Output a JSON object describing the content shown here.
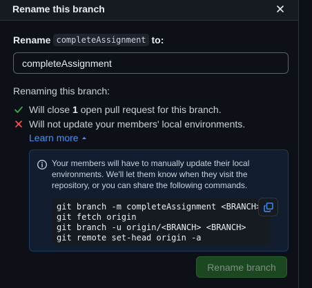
{
  "dialog": {
    "title": "Rename this branch"
  },
  "rename": {
    "prefix": "Rename",
    "branch_code": "completeAssignment",
    "suffix": "to:",
    "input_value": "completeAssignment"
  },
  "renaming": {
    "title": "Renaming this branch:",
    "items": [
      {
        "status": "ok",
        "before": "Will close",
        "count": "1",
        "after": "open pull request for this branch."
      },
      {
        "status": "fail",
        "text": "Will not update your members' local environments."
      }
    ],
    "learn_more": "Learn more"
  },
  "info": {
    "text": "Your members will have to manually update their local environments. We'll let them know when they visit the repository, or you can share the following commands.",
    "commands": [
      "git branch -m completeAssignment <BRANCH>",
      "git fetch origin",
      "git branch -u origin/<BRANCH> <BRANCH>",
      "git remote set-head origin -a"
    ]
  },
  "footer": {
    "rename_label": "Rename branch"
  },
  "colors": {
    "success": "#3fb950",
    "danger": "#f85149",
    "accent": "#4493f8"
  },
  "icons": {
    "close": "x-icon",
    "success": "check-icon",
    "fail": "x-icon",
    "info": "info-icon",
    "copy": "copy-icon",
    "chevron": "triangle-up-icon"
  }
}
